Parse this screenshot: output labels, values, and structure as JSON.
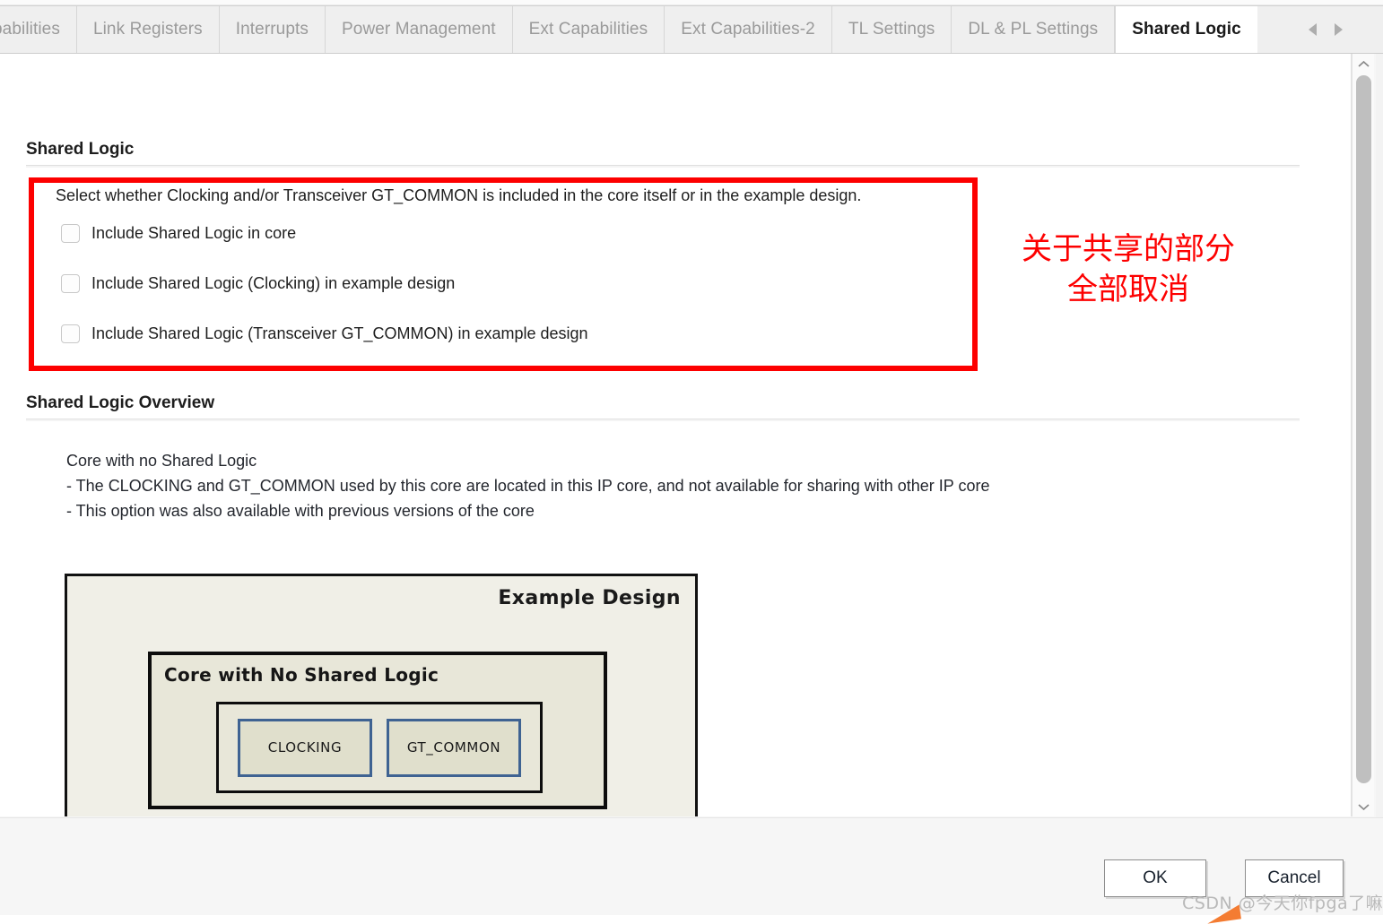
{
  "tabs": [
    {
      "label": "pabilities",
      "active": false,
      "clipped": true
    },
    {
      "label": "Link Registers",
      "active": false
    },
    {
      "label": "Interrupts",
      "active": false
    },
    {
      "label": "Power Management",
      "active": false
    },
    {
      "label": "Ext Capabilities",
      "active": false
    },
    {
      "label": "Ext Capabilities-2",
      "active": false
    },
    {
      "label": "TL Settings",
      "active": false
    },
    {
      "label": "DL & PL Settings",
      "active": false
    },
    {
      "label": "Shared Logic",
      "active": true
    }
  ],
  "tab_nav": {
    "prev_icon": "triangle-left-icon",
    "next_icon": "triangle-right-icon",
    "menu_icon": "hamburger-menu-icon"
  },
  "shared_logic": {
    "section_title": "Shared Logic",
    "intro": "Select whether Clocking and/or Transceiver GT_COMMON is included in the core itself or in the example design.",
    "options": [
      {
        "label": "Include Shared Logic in core",
        "checked": false
      },
      {
        "label": "Include Shared Logic (Clocking) in example design",
        "checked": false
      },
      {
        "label": "Include Shared Logic (Transceiver GT_COMMON) in example design",
        "checked": false
      }
    ]
  },
  "annotation": {
    "line1": "关于共享的部分",
    "line2": "全部取消",
    "color": "#fd0000"
  },
  "overview": {
    "section_title": "Shared Logic Overview",
    "heading": "Core with no Shared Logic",
    "bullets": [
      "- The CLOCKING and GT_COMMON used by this core are located in this IP core, and not available for sharing with other IP core",
      "- This option was also available with previous versions of the core"
    ]
  },
  "diagram": {
    "outer_title": "Example Design",
    "core_title": "Core with No Shared Logic",
    "blocks": [
      {
        "label": "CLOCKING"
      },
      {
        "label": "GT_COMMON"
      }
    ]
  },
  "scrollbar": {
    "up_icon": "chevron-up-icon",
    "down_icon": "chevron-down-icon"
  },
  "footer": {
    "ok_label": "OK",
    "cancel_label": "Cancel"
  },
  "watermark": {
    "text": "CSDN @今天你fpga了嘛"
  }
}
